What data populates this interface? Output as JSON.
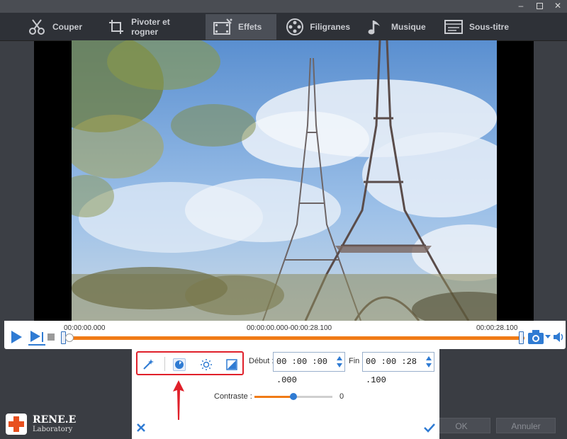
{
  "tabs": [
    {
      "label": "Couper",
      "icon": "scissors-icon"
    },
    {
      "label": "Pivoter et rogner",
      "icon": "crop-icon"
    },
    {
      "label": "Effets",
      "icon": "film-effects-icon",
      "active": true
    },
    {
      "label": "Filigranes",
      "icon": "film-reel-icon"
    },
    {
      "label": "Musique",
      "icon": "music-note-icon"
    },
    {
      "label": "Sous-titre",
      "icon": "subtitle-icon"
    }
  ],
  "window_controls": {
    "minimize": "–",
    "close": "✕"
  },
  "timeline": {
    "start_time": "00:00:00.000",
    "range": "00:00:00.000-00:00:28.100",
    "end_time": "00:00:28.100",
    "playhead_fraction": 0
  },
  "effects": {
    "tools": [
      "magic-wand-icon",
      "contrast-icon",
      "brightness-icon",
      "saturation-icon"
    ],
    "selected_tool": "contrast-icon",
    "debut_label": "Début :",
    "debut_value": "00 :00 :00 .000",
    "fin_label": "Fin :",
    "fin_value": "00 :00 :28 .100",
    "contrast_label": "Contraste :",
    "contrast_value": "0",
    "contrast_slider_fraction": 0.5
  },
  "buttons": {
    "ok": "OK",
    "annuler": "Annuler"
  },
  "logo": {
    "line1": "RENE.E",
    "line2": "Laboratory"
  },
  "colors": {
    "accent": "#2f7bd3",
    "timeline": "#f07b16",
    "highlight": "#e0202a"
  }
}
